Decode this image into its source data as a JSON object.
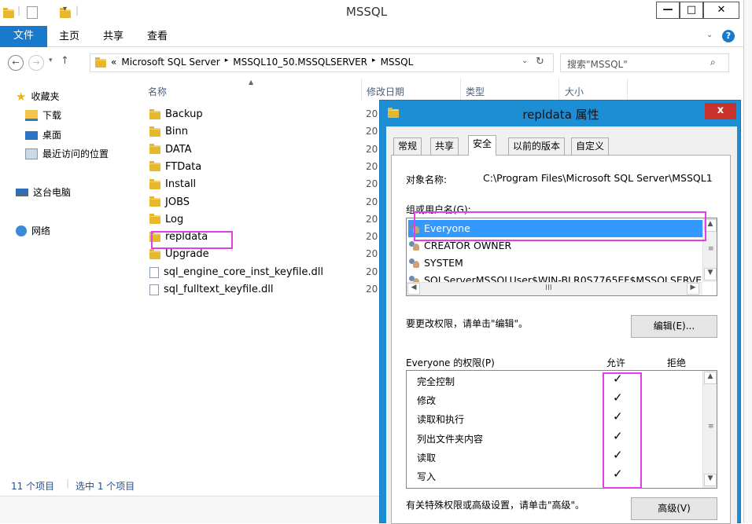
{
  "window": {
    "title": "MSSQL",
    "buttons": [
      "—",
      "□",
      "✕"
    ]
  },
  "ribbon": {
    "tabs": [
      "文件",
      "主页",
      "共享",
      "查看"
    ]
  },
  "address": {
    "crumbs": [
      "«",
      "Microsoft SQL Server",
      "▸",
      "MSSQL10_50.MSSQLSERVER",
      "▸",
      "MSSQL"
    ],
    "search_placeholder": "搜索\"MSSQL\""
  },
  "nav": {
    "favorites": "收藏夹",
    "downloads": "下载",
    "desktop": "桌面",
    "recent": "最近访问的位置",
    "thispc": "这台电脑",
    "network": "网络"
  },
  "columns": [
    "名称",
    "修改日期",
    "类型",
    "大小"
  ],
  "files": [
    {
      "name": "Backup",
      "type": "folder",
      "date": "20"
    },
    {
      "name": "Binn",
      "type": "folder",
      "date": "20"
    },
    {
      "name": "DATA",
      "type": "folder",
      "date": "20"
    },
    {
      "name": "FTData",
      "type": "folder",
      "date": "20"
    },
    {
      "name": "Install",
      "type": "folder",
      "date": "20"
    },
    {
      "name": "JOBS",
      "type": "folder",
      "date": "20"
    },
    {
      "name": "Log",
      "type": "folder",
      "date": "20"
    },
    {
      "name": "repldata",
      "type": "folder",
      "date": "20"
    },
    {
      "name": "Upgrade",
      "type": "folder",
      "date": "20"
    },
    {
      "name": "sql_engine_core_inst_keyfile.dll",
      "type": "file",
      "date": "20"
    },
    {
      "name": "sql_fulltext_keyfile.dll",
      "type": "file",
      "date": "20"
    }
  ],
  "status": {
    "count": "11 个项目",
    "selected": "选中 1 个项目"
  },
  "dialog": {
    "title": "repldata 属性",
    "close": "x",
    "tabs": [
      "常规",
      "共享",
      "安全",
      "以前的版本",
      "自定义"
    ],
    "object_label": "对象名称:",
    "object_value": "C:\\Program Files\\Microsoft SQL Server\\MSSQL1",
    "groups_label": "组或用户名(G):",
    "users": [
      "Everyone",
      "CREATOR OWNER",
      "SYSTEM",
      "SQLServerMSSQLUser$WIN-BLR0S7765EF$MSSQLSERVE"
    ],
    "hscroll_mid": "III",
    "edit_hint": "要更改权限，请单击\"编辑\"。",
    "edit_button": "编辑(E)...",
    "perm_label": "Everyone 的权限(P)",
    "allow": "允许",
    "deny": "拒绝",
    "permissions": [
      {
        "name": "完全控制",
        "allow": "✓"
      },
      {
        "name": "修改",
        "allow": "✓"
      },
      {
        "name": "读取和执行",
        "allow": "✓"
      },
      {
        "name": "列出文件夹内容",
        "allow": "✓"
      },
      {
        "name": "读取",
        "allow": "✓"
      },
      {
        "name": "写入",
        "allow": "✓"
      }
    ],
    "advanced_hint": "有关特殊权限或高级设置，请单击\"高级\"。",
    "advanced_button": "高级(V)"
  },
  "colors": {
    "accent": "#1979ca",
    "dialog_frame": "#1e8ed4",
    "selection": "#3399ff",
    "highlight": "#e040e6"
  }
}
